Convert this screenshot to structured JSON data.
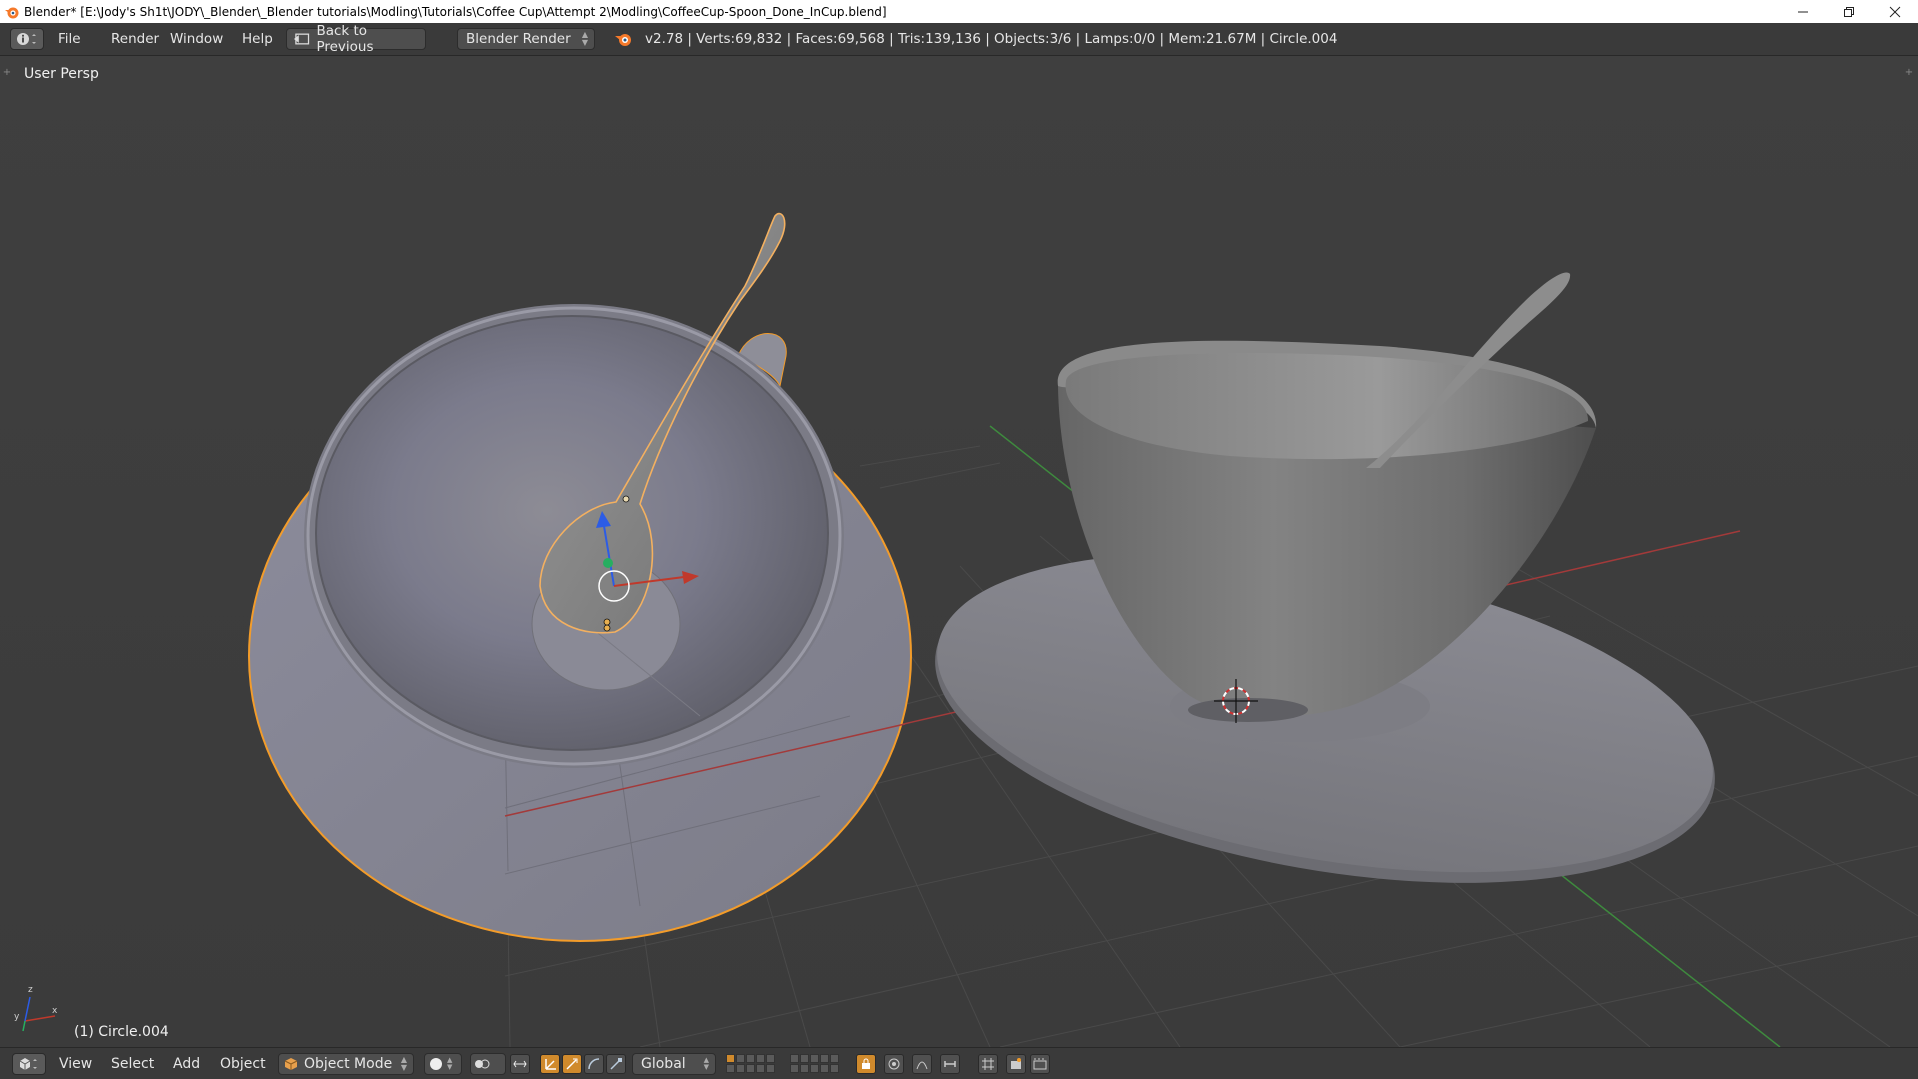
{
  "window": {
    "title": "Blender* [E:\\Jody's Sh1t\\JODY\\_Blender\\_Blender tutorials\\Modling\\Tutorials\\Coffee Cup\\Attempt 2\\Modling\\CoffeeCup-Spoon_Done_InCup.blend]",
    "controls": [
      "minimize",
      "restore",
      "close"
    ]
  },
  "infobar": {
    "menus": [
      "File",
      "Render",
      "Window",
      "Help"
    ],
    "back_label": "Back to Previous",
    "render_engine": "Blender Render",
    "stats": "v2.78 | Verts:69,832 | Faces:69,568 | Tris:139,136 | Objects:3/6 | Lamps:0/0 | Mem:21.67M | Circle.004"
  },
  "viewport": {
    "view_label": "User Persp",
    "active_object_label": "(1) Circle.004",
    "axis_labels": {
      "x": "x",
      "y": "y",
      "z": "z"
    },
    "colors": {
      "selection": "#f39c2a",
      "x_axis": "#c0392b",
      "y_axis": "#27ae60",
      "z_axis": "#2c5ce6"
    }
  },
  "bottombar": {
    "menus": [
      "View",
      "Select",
      "Add",
      "Object"
    ],
    "mode": "Object Mode",
    "orientation": "Global"
  },
  "icons": [
    "blender-logo-icon",
    "info-editor-icon",
    "view3d-editor-icon",
    "cursor-icon",
    "translate-icon",
    "rotate-icon",
    "scale-icon",
    "snap-icon",
    "proportional-icon",
    "render-icon",
    "camera-icon"
  ]
}
